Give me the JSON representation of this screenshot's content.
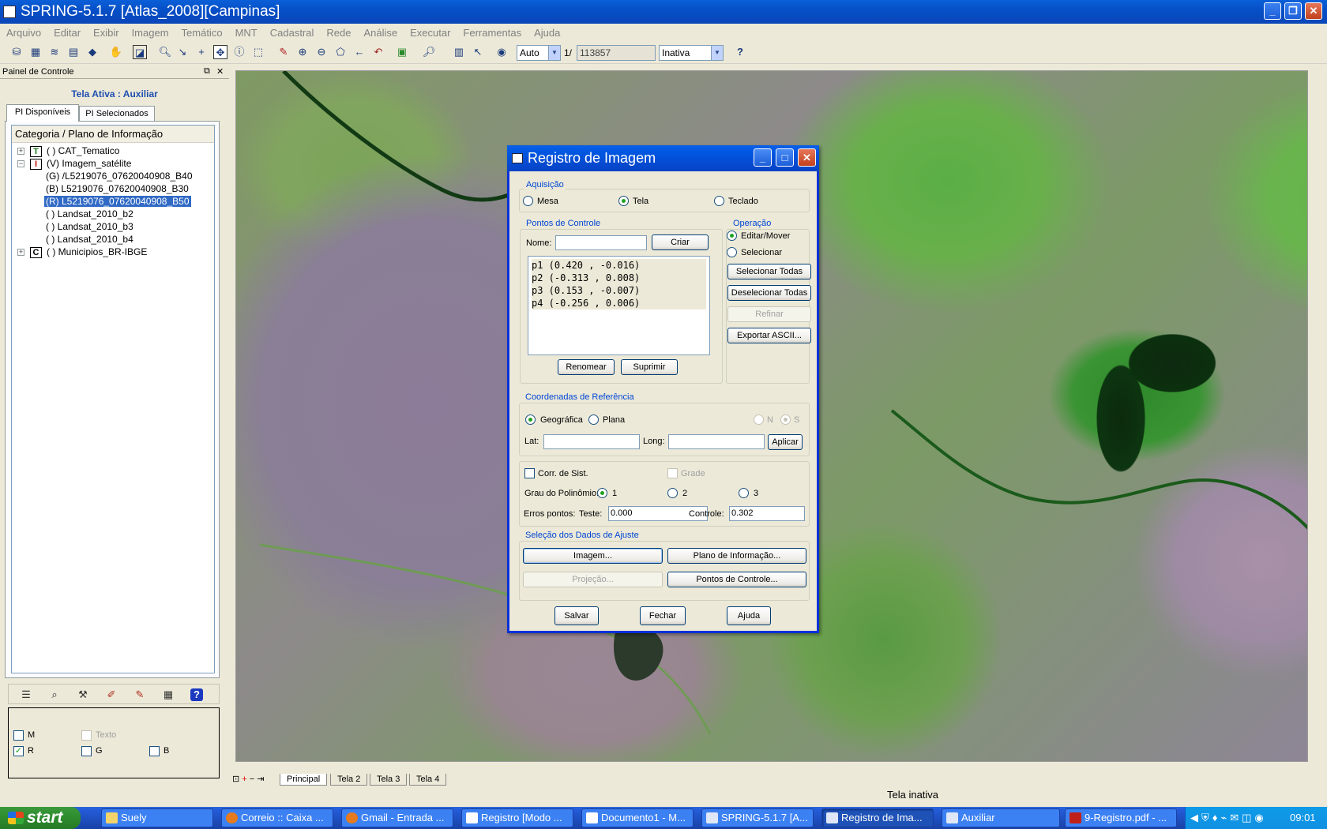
{
  "window": {
    "title": "SPRING-5.1.7 [Atlas_2008][Campinas]"
  },
  "menu": [
    "Arquivo",
    "Editar",
    "Exibir",
    "Imagem",
    "Temático",
    "MNT",
    "Cadastral",
    "Rede",
    "Análise",
    "Executar",
    "Ferramentas",
    "Ajuda"
  ],
  "toolbar": {
    "scale_mode": "Auto",
    "scale_prefix": "1/",
    "scale_value": "113857",
    "cursor_mode": "Inativa",
    "help": "?"
  },
  "panel": {
    "title": "Painel de Controle",
    "tela_ativa": "Tela Ativa : Auxiliar",
    "tabs": [
      "PI Disponíveis",
      "PI Selecionados"
    ],
    "tree_header": "Categoria / Plano de Informação",
    "tree": [
      {
        "box": "T",
        "text": "( ) CAT_Tematico"
      },
      {
        "box": "I",
        "text": "(V) Imagem_satélite"
      },
      {
        "text": "(G) /L5219076_07620040908_B40"
      },
      {
        "text": "(B) L5219076_07620040908_B30"
      },
      {
        "text": "(R) L5219076_07620040908_B50"
      },
      {
        "text": "( ) Landsat_2010_b2"
      },
      {
        "text": "( ) Landsat_2010_b3"
      },
      {
        "text": "( ) Landsat_2010_b4"
      },
      {
        "box": "C",
        "text": "( ) Municipios_BR-IBGE"
      }
    ],
    "channels": {
      "m": "M",
      "texto": "Texto",
      "r": "R",
      "g": "G",
      "b": "B"
    }
  },
  "dialog": {
    "title": "Registro de Imagem",
    "aquisicao": {
      "label": "Aquisição",
      "options": [
        "Mesa",
        "Tela",
        "Teclado"
      ],
      "selected": "Tela"
    },
    "pontos": {
      "label": "Pontos de Controle",
      "nome_label": "Nome:",
      "nome_value": "",
      "criar": "Criar",
      "list": [
        "p1 (0.420 , -0.016)",
        "p2 (-0.313 , 0.008)",
        "p3 (0.153 , -0.007)",
        "p4 (-0.256 , 0.006)"
      ],
      "renomear": "Renomear",
      "suprimir": "Suprimir"
    },
    "operacao": {
      "label": "Operação",
      "options": [
        "Editar/Mover",
        "Selecionar"
      ],
      "selected": "Editar/Mover",
      "selecionar_todas": "Selecionar Todas",
      "deselecionar_todas": "Deselecionar Todas",
      "refinar": "Refinar",
      "exportar": "Exportar ASCII..."
    },
    "coord": {
      "label": "Coordenadas de Referência",
      "options": [
        "Geográfica",
        "Plana"
      ],
      "selected": "Geográfica",
      "n": "N",
      "s": "S",
      "lat_label": "Lat:",
      "long_label": "Long:",
      "aplicar": "Aplicar"
    },
    "ajuste": {
      "corr_sist": "Corr. de Sist.",
      "grade": "Grade",
      "grau_label": "Grau do Polinômio:",
      "grau_options": [
        "1",
        "2",
        "3"
      ],
      "grau_selected": "1",
      "erros_label": "Erros pontos:",
      "teste_label": "Teste:",
      "teste_value": "0.000",
      "controle_label": "Controle:",
      "controle_value": "0.302"
    },
    "selecao": {
      "label": "Seleção dos Dados de Ajuste",
      "imagem": "Imagem...",
      "plano": "Plano de Informação...",
      "projecao": "Projeção...",
      "pontos": "Pontos de Controle..."
    },
    "salvar": "Salvar",
    "fechar": "Fechar",
    "ajuda": "Ajuda"
  },
  "screen_tabs": [
    "Principal",
    "Tela 2",
    "Tela 3",
    "Tela 4"
  ],
  "status": "Tela inativa",
  "taskbar": {
    "start": "start",
    "items": [
      "Suely",
      "Correio :: Caixa ...",
      "Gmail - Entrada ...",
      "Registro [Modo ...",
      "Documento1 - M...",
      "SPRING-5.1.7 [A...",
      "Registro de Ima...",
      "Auxiliar",
      "9-Registro.pdf - ..."
    ],
    "clock": "09:01"
  }
}
